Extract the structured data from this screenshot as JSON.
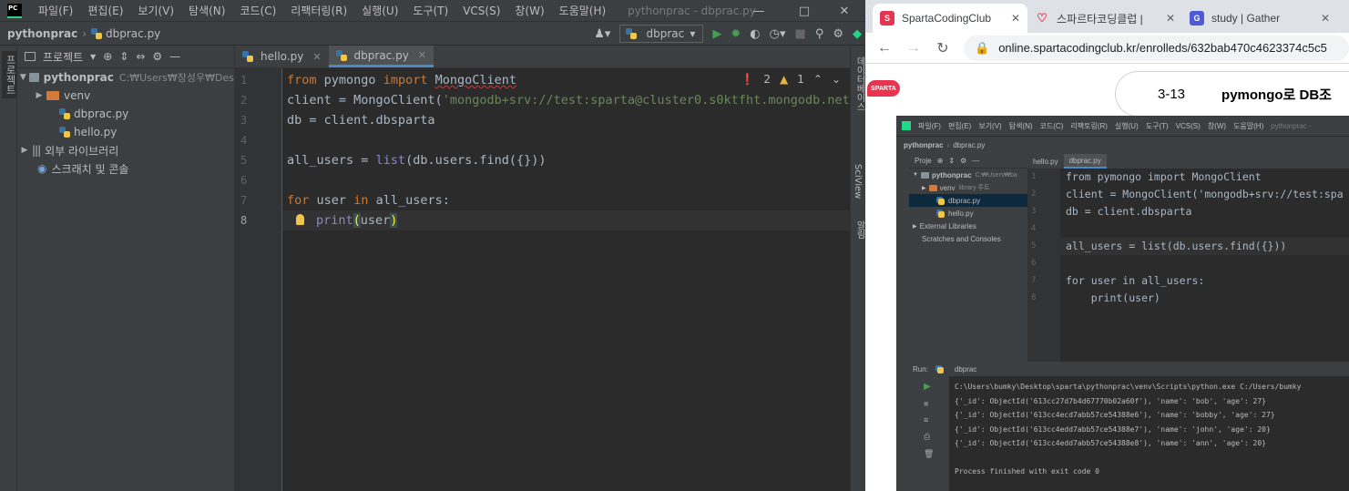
{
  "ide": {
    "logo": "PC",
    "menu": [
      "파일(F)",
      "편집(E)",
      "보기(V)",
      "탐색(N)",
      "코드(C)",
      "리팩터링(R)",
      "실행(U)",
      "도구(T)",
      "VCS(S)",
      "창(W)",
      "도움말(H)"
    ],
    "window_title": "pythonprac - dbprac.py",
    "breadcrumb": {
      "project": "pythonprac",
      "file": "dbprac.py"
    },
    "run_config": "dbprac",
    "project_panel": {
      "title": "프로젝트",
      "root_name": "pythonprac",
      "root_path": "C:₩Users₩장성우₩Des",
      "items": [
        "venv",
        "dbprac.py",
        "hello.py"
      ],
      "external_libraries": "외부 라이브러리",
      "scratches": "스크래치 및 콘솔"
    },
    "left_strip_label": "프로젝트",
    "tabs": [
      "hello.py",
      "dbprac.py"
    ],
    "inspection": {
      "errors": "2",
      "warnings": "1"
    },
    "line_numbers": [
      "1",
      "2",
      "3",
      "4",
      "5",
      "6",
      "7",
      "8"
    ],
    "code": {
      "l1_from": "from",
      "l1_mod": "pymongo",
      "l1_import": "import",
      "l1_cls": "MongoClient",
      "l2_var": "client = ",
      "l2_cls": "MongoClient",
      "l2_paren": "(",
      "l2_str": "'mongodb+srv://test:sparta@cluster0.s0ktfht.mongodb.net/",
      "l3": "db = client.dbsparta",
      "l5_var": "all_users = ",
      "l5_list": "list",
      "l5_rest": "(db.users.find({}))",
      "l7_for": "for",
      "l7_user": " user ",
      "l7_in": "in",
      "l7_rest": " all_users:",
      "l8_print": "print",
      "l8_open": "(",
      "l8_arg": "user",
      "l8_close": ")"
    },
    "right_strip": [
      "데이터베이스",
      "SciView",
      "알림"
    ]
  },
  "browser": {
    "tabs": [
      {
        "title": "SpartaCodingClub",
        "favicon_color": "#e8344e"
      },
      {
        "title": "스파르타코딩클럽 |",
        "favicon_color": "#e8344e"
      },
      {
        "title": "study | Gather",
        "favicon_color": "#4f5bd5"
      }
    ],
    "url": "online.spartacodingclub.kr/enrolleds/632bab470c4623374c5c5",
    "logo": "SPARTA",
    "lesson_number": "3-13",
    "lesson_title": "pymongo로 DB조",
    "embedded_ide": {
      "menu": [
        "파일(F)",
        "편집(E)",
        "보기(V)",
        "탐색(N)",
        "코드(C)",
        "리팩토링(R)",
        "실행(U)",
        "도구(T)",
        "VCS(S)",
        "창(W)",
        "도움말(H)",
        "pythonprac -"
      ],
      "breadcrumb": {
        "project": "pythonprac",
        "file": "dbprac.py"
      },
      "project_label": "Proje",
      "root_name": "pythonprac",
      "root_path": "C:₩Users₩ba",
      "venv": "venv",
      "venv_tag": "library 루트",
      "files": [
        "dbprac.py",
        "hello.py"
      ],
      "external_libraries": "External Libraries",
      "scratches": "Scratches and Consoles",
      "tabs": [
        "hello.py",
        "dbprac.py"
      ],
      "line_numbers": [
        "1",
        "2",
        "3",
        "4",
        "5",
        "6",
        "7",
        "8"
      ],
      "code": {
        "l1": "from pymongo import MongoClient",
        "l2": "client = MongoClient('mongodb+srv://test:spa",
        "l3": "db = client.dbsparta",
        "l5": "all_users = list(db.users.find({}))",
        "l7": "for user in all_users:",
        "l8": "    print(user)"
      },
      "run_label": "Run:",
      "run_config": "dbprac",
      "output": [
        "C:\\Users\\bumky\\Desktop\\sparta\\pythonprac\\venv\\Scripts\\python.exe C:/Users/bumky",
        "{'_id': ObjectId('613cc27d7b4d67770b02a60f'), 'name': 'bob', 'age': 27}",
        "{'_id': ObjectId('613cc4ecd7abb57ce54388e6'), 'name': 'bobby', 'age': 27}",
        "{'_id': ObjectId('613cc4edd7abb57ce54388e7'), 'name': 'john', 'age': 20}",
        "{'_id': ObjectId('613cc4edd7abb57ce54388e8'), 'name': 'ann', 'age': 20}",
        "",
        "Process finished with exit code 0"
      ]
    }
  }
}
